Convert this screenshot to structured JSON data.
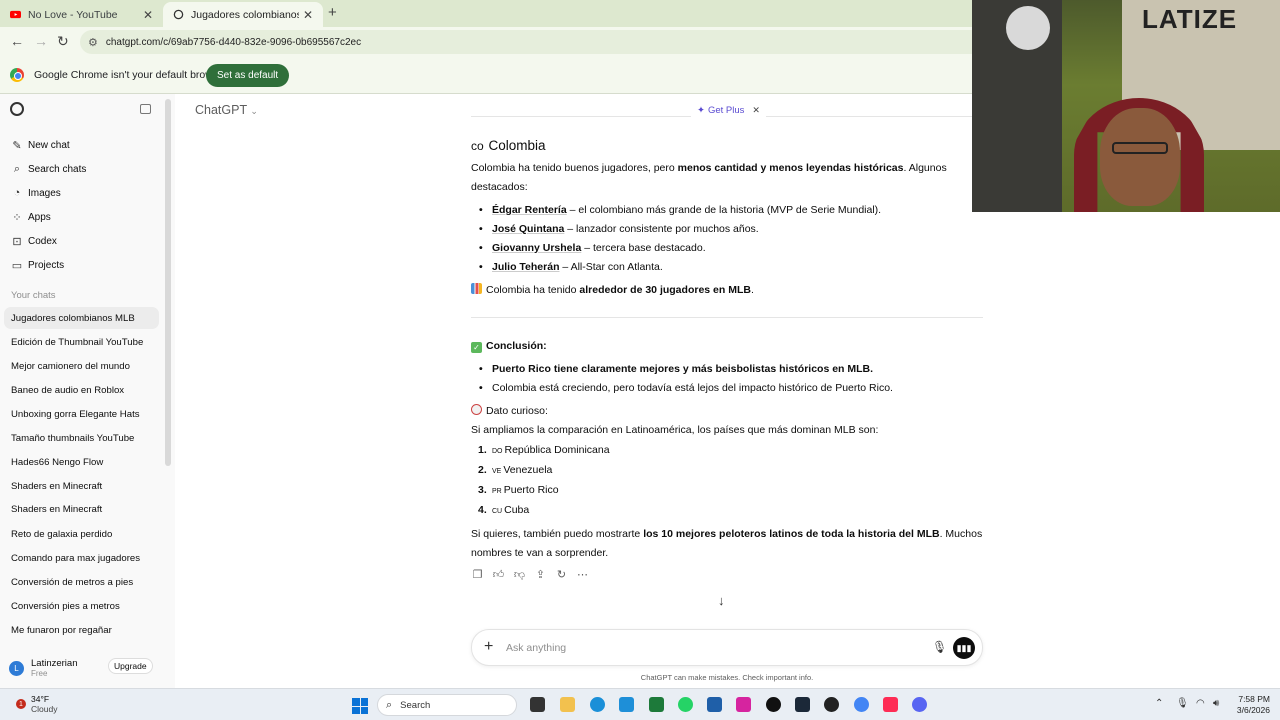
{
  "browser": {
    "tabs": [
      {
        "title": "No Love - YouTube"
      },
      {
        "title": "Jugadores colombianos MLB"
      }
    ],
    "url": "chatgpt.com/c/69ab7756-d440-832e-9096-0b695567c2ec",
    "infobar": {
      "message": "Google Chrome isn't your default browser",
      "button": "Set as default"
    }
  },
  "sidebar": {
    "items": [
      {
        "icon": "edit-icon",
        "label": "New chat"
      },
      {
        "icon": "search-icon",
        "label": "Search chats"
      },
      {
        "icon": "images-icon",
        "label": "Images"
      },
      {
        "icon": "apps-icon",
        "label": "Apps"
      },
      {
        "icon": "codex-icon",
        "label": "Codex"
      },
      {
        "icon": "folder-icon",
        "label": "Projects"
      }
    ],
    "section_label": "Your chats",
    "chats": [
      "Jugadores colombianos MLB",
      "Edición de Thumbnail YouTube",
      "Mejor camionero del mundo",
      "Baneo de audio en Roblox",
      "Unboxing gorra Elegante Hats",
      "Tamaño thumbnails YouTube",
      "Hades66 Nengo Flow",
      "Shaders en Minecraft",
      "Shaders en Minecraft",
      "Reto de galaxia perdido",
      "Comando para max jugadores",
      "Conversión de metros a pies",
      "Conversión pies a metros",
      "Me funaron por regañar"
    ],
    "user": {
      "initial": "L",
      "name": "Latinzerian",
      "plan": "Free",
      "upgrade": "Upgrade"
    }
  },
  "header": {
    "model": "ChatGPT",
    "get_plus": "Get Plus"
  },
  "message": {
    "colombia_heading_flag": "co",
    "colombia_heading": "Colombia",
    "intro_a": "Colombia ha tenido buenos jugadores, pero ",
    "intro_bold": "menos cantidad y menos leyendas históricas",
    "intro_b": ". Algunos destacados:",
    "players": [
      {
        "name": "Édgar Rentería",
        "desc": " – el colombiano más grande de la historia (MVP de Serie Mundial)."
      },
      {
        "name": "José Quintana",
        "desc": " – lanzador consistente por muchos años."
      },
      {
        "name": "Giovanny Urshela",
        "desc": " – tercera base destacado."
      },
      {
        "name": "Julio Teherán",
        "desc": " – All-Star con Atlanta."
      }
    ],
    "count_a": "Colombia ha tenido ",
    "count_bold": "alrededor de 30 jugadores en MLB",
    "count_b": ".",
    "conclusion_title": "Conclusión:",
    "conclusion_1": "Puerto Rico tiene claramente mejores y más beisbolistas históricos en MLB.",
    "conclusion_2": "Colombia está creciendo, pero todavía está lejos del impacto histórico de Puerto Rico.",
    "fun_fact": "Dato curioso:",
    "fun_fact_text": "Si ampliamos la comparación en Latinoamérica, los países que más dominan MLB son:",
    "countries": [
      {
        "num": "1.",
        "code": "DO",
        "name": "República Dominicana"
      },
      {
        "num": "2.",
        "code": "VE",
        "name": "Venezuela"
      },
      {
        "num": "3.",
        "code": "PR",
        "name": "Puerto Rico"
      },
      {
        "num": "4.",
        "code": "CU",
        "name": "Cuba"
      }
    ],
    "offer_a": "Si quieres, también puedo mostrarte ",
    "offer_bold": "los 10 mejores peloteros latinos de toda la historia del MLB",
    "offer_b": ". Muchos nombres te van a sorprender."
  },
  "composer": {
    "placeholder": "Ask anything",
    "disclaimer": "ChatGPT can make mistakes. Check important info."
  },
  "taskbar": {
    "notification_count": "1",
    "temperature": "34°F",
    "condition": "Cloudy",
    "search": "Search",
    "time": "7:58 PM",
    "date": "3/6/2026"
  },
  "webcam": {
    "graffiti": "LATIZE"
  },
  "colors": {
    "accent_green": "#2f6f3a",
    "get_plus_purple": "#5a4bd1",
    "chrome_bg": "#dde8cf"
  }
}
